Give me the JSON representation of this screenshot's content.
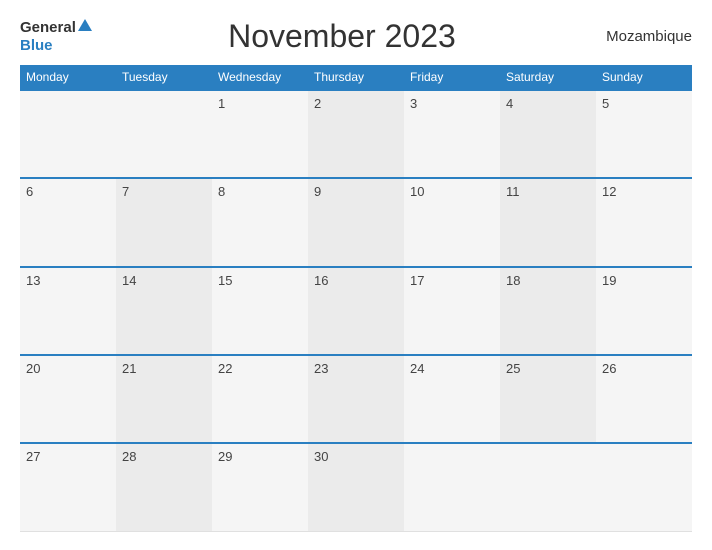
{
  "header": {
    "logo_general": "General",
    "logo_blue": "Blue",
    "title": "November 2023",
    "country": "Mozambique"
  },
  "columns": [
    "Monday",
    "Tuesday",
    "Wednesday",
    "Thursday",
    "Friday",
    "Saturday",
    "Sunday"
  ],
  "weeks": [
    [
      "",
      "",
      "1",
      "2",
      "3",
      "4",
      "5"
    ],
    [
      "6",
      "7",
      "8",
      "9",
      "10",
      "11",
      "12"
    ],
    [
      "13",
      "14",
      "15",
      "16",
      "17",
      "18",
      "19"
    ],
    [
      "20",
      "21",
      "22",
      "23",
      "24",
      "25",
      "26"
    ],
    [
      "27",
      "28",
      "29",
      "30",
      "",
      "",
      ""
    ]
  ]
}
